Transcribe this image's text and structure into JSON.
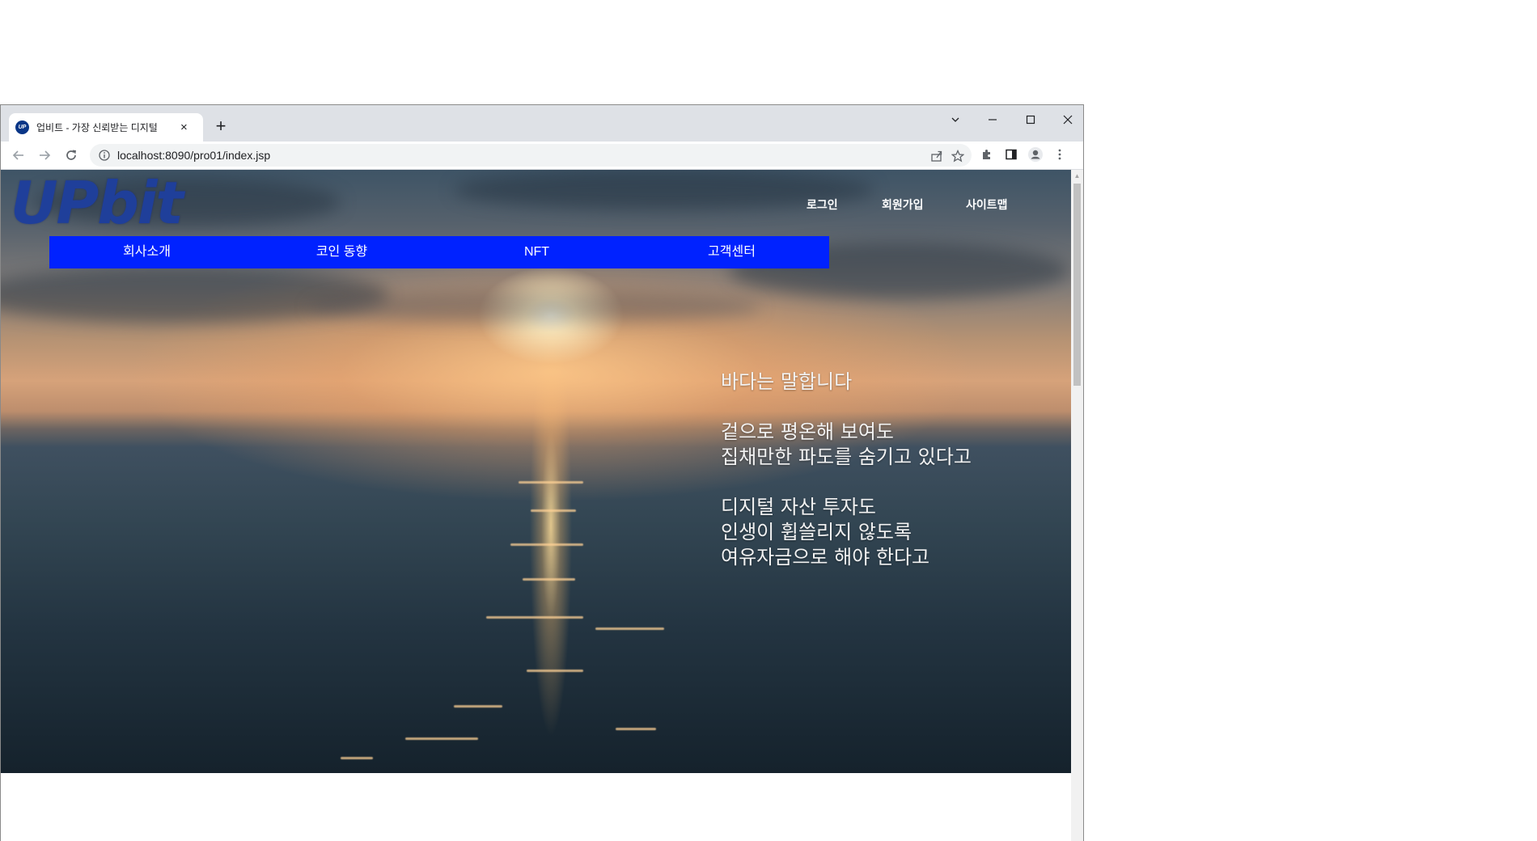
{
  "browser": {
    "tab": {
      "favicon_text": "UP",
      "title": "업비트 - 가장 신뢰받는 디지털",
      "close": "×"
    },
    "new_tab": "+",
    "url": "localhost:8090/pro01/index.jsp"
  },
  "site": {
    "logo": "UPbit",
    "util_nav": [
      "로그인",
      "회원가입",
      "사이트맵"
    ],
    "gnb": [
      "회사소개",
      "코인 동향",
      "NFT",
      "고객센터"
    ],
    "poem": [
      "바다는 말합니다",
      "겉으로 평온해 보여도",
      "집채만한 파도를 숨기고 있다고",
      "디지털 자산 투자도",
      "인생이 휩쓸리지 않도록",
      "여유자금으로 해야 한다고"
    ]
  },
  "colors": {
    "gnb_background": "#0022ff",
    "logo": "#1f3f9a"
  }
}
